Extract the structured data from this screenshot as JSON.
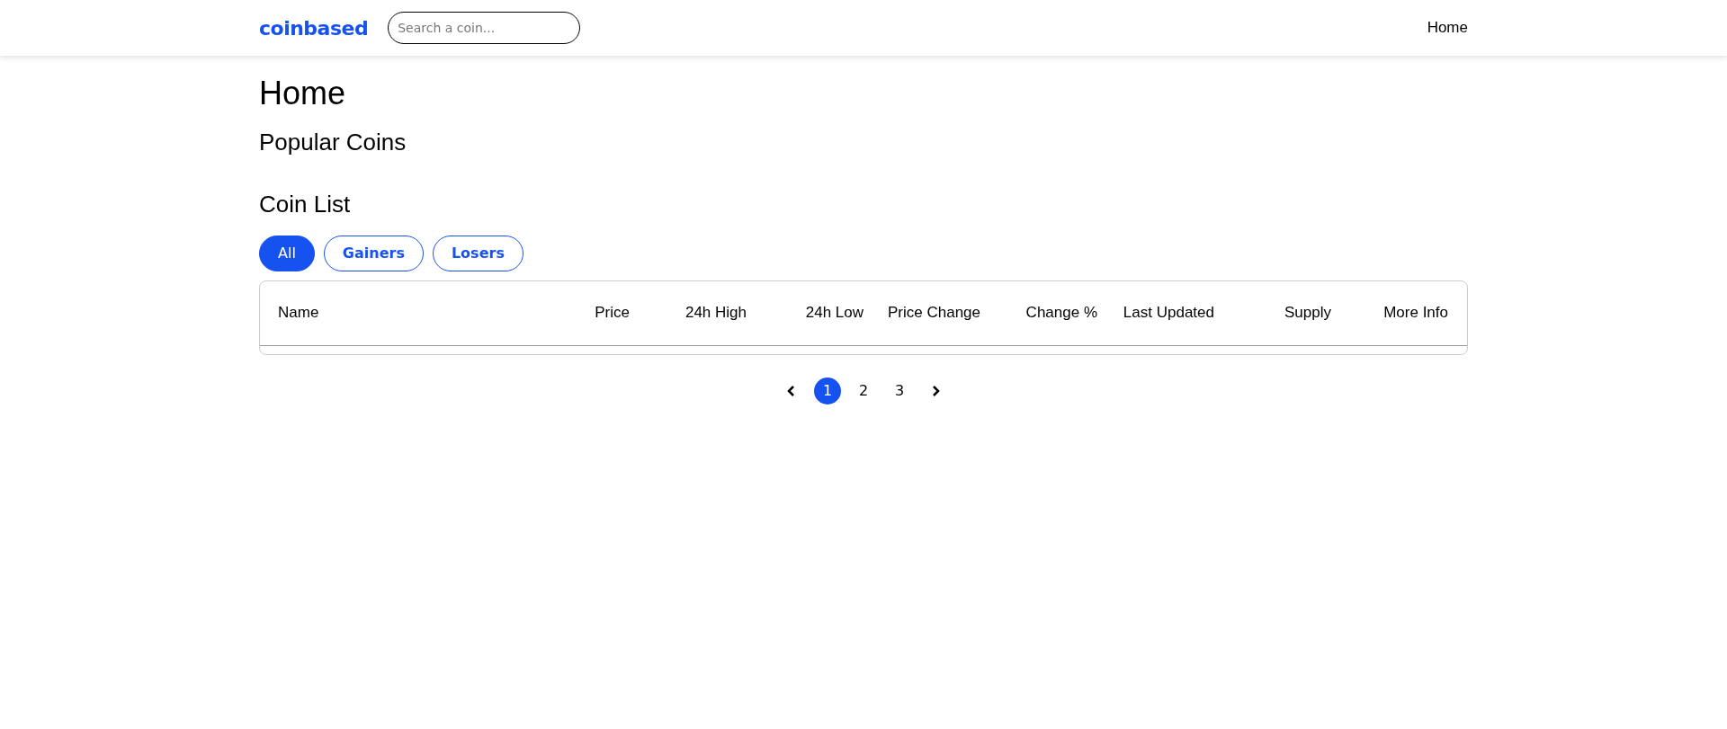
{
  "header": {
    "logo": "coinbased",
    "search": {
      "placeholder": "Search a coin..."
    },
    "nav": [
      {
        "label": "Home"
      }
    ]
  },
  "page_title": "Home",
  "popular_coins": {
    "title": "Popular Coins"
  },
  "coin_list": {
    "title": "Coin List",
    "filters": [
      {
        "label": "All",
        "selected": true
      },
      {
        "label": "Gainers",
        "selected": false
      },
      {
        "label": "Losers",
        "selected": false
      }
    ],
    "table": {
      "columns": [
        "Name",
        "Price",
        "24h High",
        "24h Low",
        "Price Change",
        "Change %",
        "Last Updated",
        "Supply",
        "More Info"
      ]
    }
  },
  "pagination": {
    "pages": [
      {
        "label": "1",
        "selected": true
      },
      {
        "label": "2",
        "selected": false
      },
      {
        "label": "3",
        "selected": false
      }
    ]
  }
}
